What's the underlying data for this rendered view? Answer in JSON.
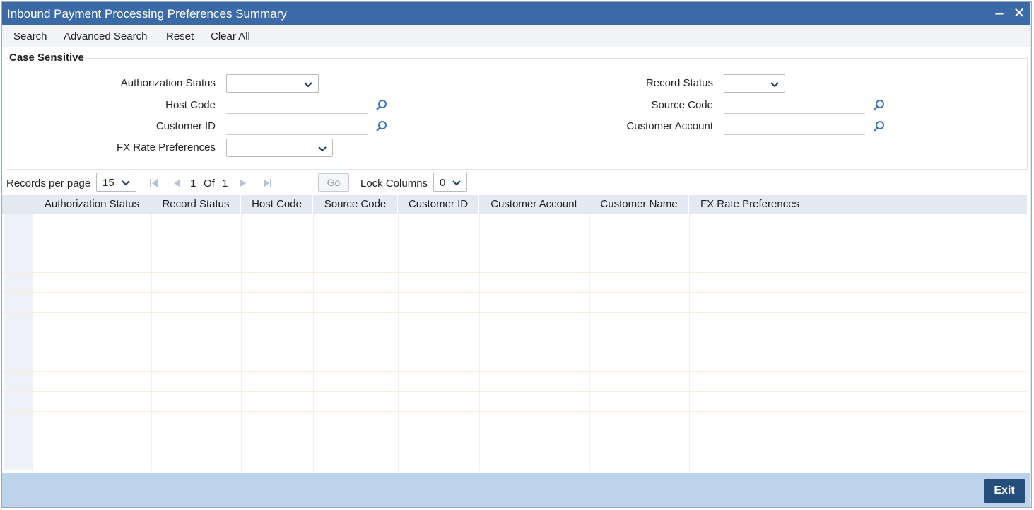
{
  "window": {
    "title": "Inbound Payment Processing Preferences Summary",
    "minimize_glyph": "‒",
    "close_glyph": "✕"
  },
  "menu": {
    "search": "Search",
    "advanced_search": "Advanced Search",
    "reset": "Reset",
    "clear_all": "Clear All"
  },
  "criteria": {
    "legend": "Case Sensitive",
    "authorization_status": {
      "label": "Authorization Status",
      "value": ""
    },
    "record_status": {
      "label": "Record Status",
      "value": ""
    },
    "host_code": {
      "label": "Host Code",
      "value": ""
    },
    "source_code": {
      "label": "Source Code",
      "value": ""
    },
    "customer_id": {
      "label": "Customer ID",
      "value": ""
    },
    "customer_account": {
      "label": "Customer Account",
      "value": ""
    },
    "fx_rate_preferences": {
      "label": "FX Rate Preferences",
      "value": ""
    }
  },
  "pager": {
    "records_per_page_label": "Records per page",
    "records_per_page_value": "15",
    "current_page": "1",
    "of_label": "Of",
    "total_pages": "1",
    "go_label": "Go",
    "lock_columns_label": "Lock Columns",
    "lock_columns_value": "0"
  },
  "grid": {
    "columns": [
      "Authorization Status",
      "Record Status",
      "Host Code",
      "Source Code",
      "Customer ID",
      "Customer Account",
      "Customer Name",
      "FX Rate Preferences"
    ],
    "rows": []
  },
  "footer": {
    "exit_label": "Exit"
  },
  "colors": {
    "titlebar": "#3b6aa6",
    "footer": "#bcd3e9",
    "exit_button": "#234f7a",
    "grid_header": "#e3e9f1"
  }
}
